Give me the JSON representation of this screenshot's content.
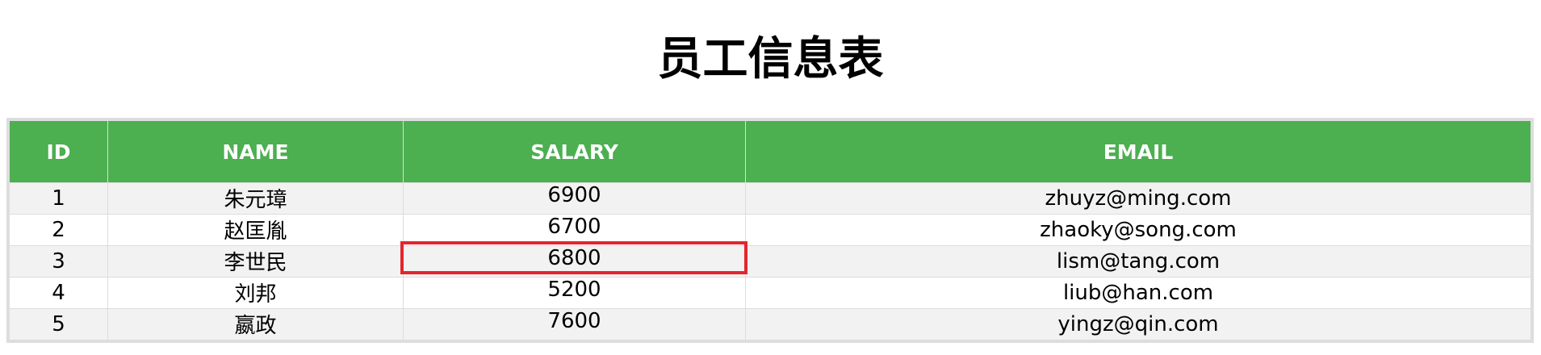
{
  "title": "员工信息表",
  "table": {
    "headers": [
      "ID",
      "NAME",
      "SALARY",
      "EMAIL"
    ],
    "rows": [
      {
        "id": "1",
        "name": "朱元璋",
        "salary": "6900",
        "email": "zhuyz@ming.com"
      },
      {
        "id": "2",
        "name": "赵匡胤",
        "salary": "6700",
        "email": "zhaoky@song.com"
      },
      {
        "id": "3",
        "name": "李世民",
        "salary": "6800",
        "email": "lism@tang.com"
      },
      {
        "id": "4",
        "name": "刘邦",
        "salary": "5200",
        "email": "liub@han.com"
      },
      {
        "id": "5",
        "name": "嬴政",
        "salary": "7600",
        "email": "yingz@qin.com"
      }
    ]
  },
  "colors": {
    "header_bg": "#4caf50",
    "header_text": "#ffffff",
    "row_odd_bg": "#f2f2f2",
    "border": "#dddddd",
    "highlight": "#e3262d"
  }
}
